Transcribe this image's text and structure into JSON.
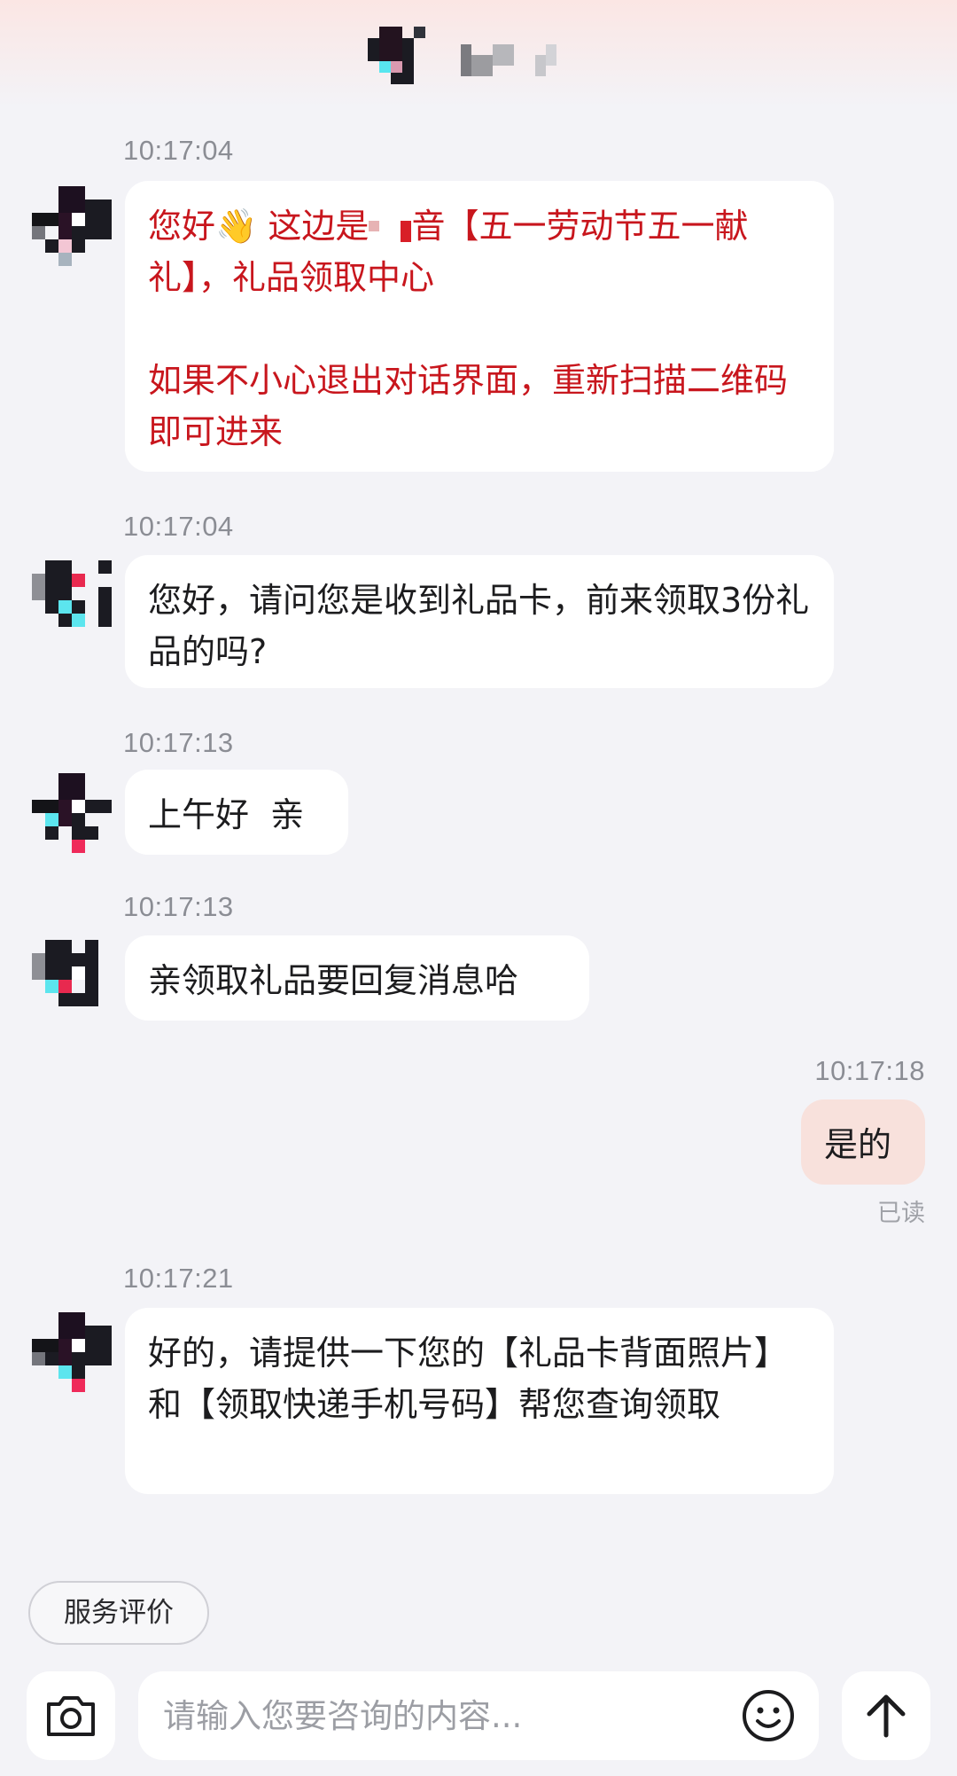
{
  "header": {
    "contact_name": ""
  },
  "messages": [
    {
      "time": "10:17:04",
      "line1_a": "您好",
      "wave": "👋",
      "line1_b": "  这边是",
      "line1_c": "音【五一劳动节五一献礼】，礼品领取中心",
      "line2": "如果不小心退出对话界面，重新扫描二维码即可进来"
    },
    {
      "time": "10:17:04",
      "text": "您好，请问您是收到礼品卡，前来领取3份礼品的吗?"
    },
    {
      "time": "10:17:13",
      "text": "上午好  亲"
    },
    {
      "time": "10:17:13",
      "text": "亲领取礼品要回复消息哈"
    },
    {
      "time": "10:17:18",
      "text": "是的",
      "status": "已读"
    },
    {
      "time": "10:17:21",
      "text": "好的，请提供一下您的【礼品卡背面照片】 和【领取快递手机号码】帮您查询领取"
    }
  ],
  "footer": {
    "rate_label": "服务评价",
    "input_placeholder": "请输入您要咨询的内容...",
    "camera_icon": "camera-icon",
    "emoji_icon": "smiley-icon",
    "send_icon": "arrow-up-icon"
  },
  "colors": {
    "accent_red": "#c8161d",
    "my_bubble": "#f8e1dc",
    "background": "#f3f3f7"
  }
}
